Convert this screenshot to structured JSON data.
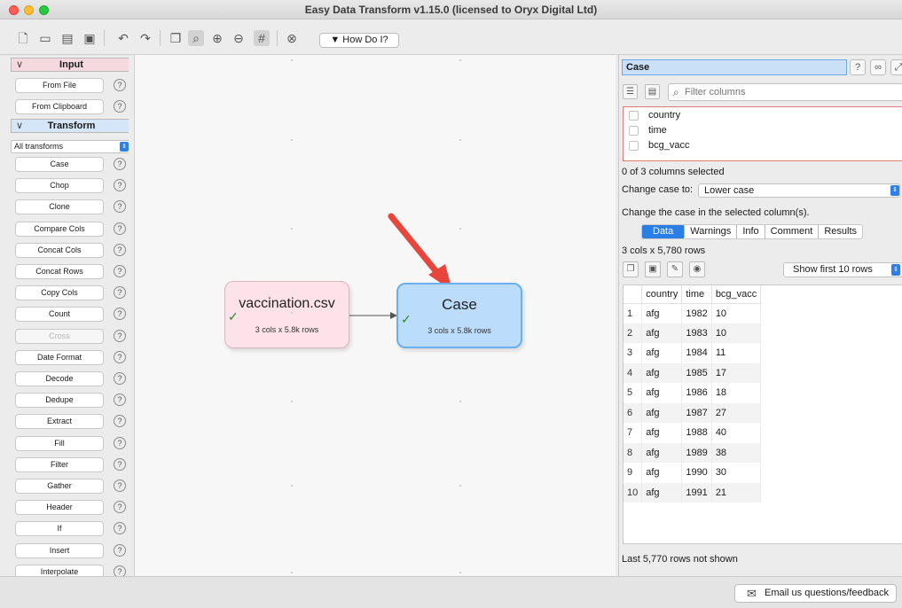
{
  "window": {
    "title": "Easy Data Transform v1.15.0 (licensed to Oryx Digital Ltd)"
  },
  "toolbar": {
    "icons": [
      "new-file-icon",
      "open-folder-icon",
      "open-recent-icon",
      "save-icon",
      "undo-icon",
      "redo-icon",
      "copy-icon",
      "zoom-fit-icon",
      "zoom-in-icon",
      "zoom-out-icon",
      "grid-icon",
      "stop-icon"
    ],
    "how_do_i": "▼ How Do I?"
  },
  "left_panel": {
    "input_header": "Input",
    "input_items": [
      "From File",
      "From Clipboard"
    ],
    "transform_header": "Transform",
    "transform_filter": "All transforms",
    "transform_items": [
      "Case",
      "Chop",
      "Clone",
      "Compare Cols",
      "Concat Cols",
      "Concat Rows",
      "Copy Cols",
      "Count",
      "Cross",
      "Date Format",
      "Decode",
      "Dedupe",
      "Extract",
      "Fill",
      "Filter",
      "Gather",
      "Header",
      "If",
      "Insert",
      "Interpolate"
    ]
  },
  "canvas": {
    "input_node": {
      "name": "vaccination.csv",
      "info": "3 cols x 5.8k rows"
    },
    "case_node": {
      "name": "Case",
      "info": "3 cols x 5.8k rows"
    },
    "colors": {
      "input_fill": "#fde2ea",
      "transform_fill": "#bcdcfb",
      "arrow": "#e8453c"
    }
  },
  "right_panel": {
    "name": "Case",
    "filter_placeholder": "Filter columns",
    "columns": [
      "country",
      "time",
      "bcg_vacc"
    ],
    "selected_summary": "0 of 3 columns selected",
    "change_case_label": "Change case to:",
    "change_case_value": "Lower case",
    "description": "Change the case in the selected column(s).",
    "tabs": [
      "Data",
      "Warnings",
      "Info",
      "Comment",
      "Results"
    ],
    "active_tab": "Data",
    "dims": "3 cols x 5,780 rows",
    "show_rows": "Show first 10 rows",
    "table": {
      "headers": [
        "country",
        "time",
        "bcg_vacc"
      ],
      "rows": [
        [
          "1",
          "afg",
          "1982",
          "10"
        ],
        [
          "2",
          "afg",
          "1983",
          "10"
        ],
        [
          "3",
          "afg",
          "1984",
          "11"
        ],
        [
          "4",
          "afg",
          "1985",
          "17"
        ],
        [
          "5",
          "afg",
          "1986",
          "18"
        ],
        [
          "6",
          "afg",
          "1987",
          "27"
        ],
        [
          "7",
          "afg",
          "1988",
          "40"
        ],
        [
          "8",
          "afg",
          "1989",
          "38"
        ],
        [
          "9",
          "afg",
          "1990",
          "30"
        ],
        [
          "10",
          "afg",
          "1991",
          "21"
        ]
      ]
    },
    "footer": "Last 5,770 rows not shown"
  },
  "status_bar": {
    "email_button": "Email us questions/feedback"
  }
}
